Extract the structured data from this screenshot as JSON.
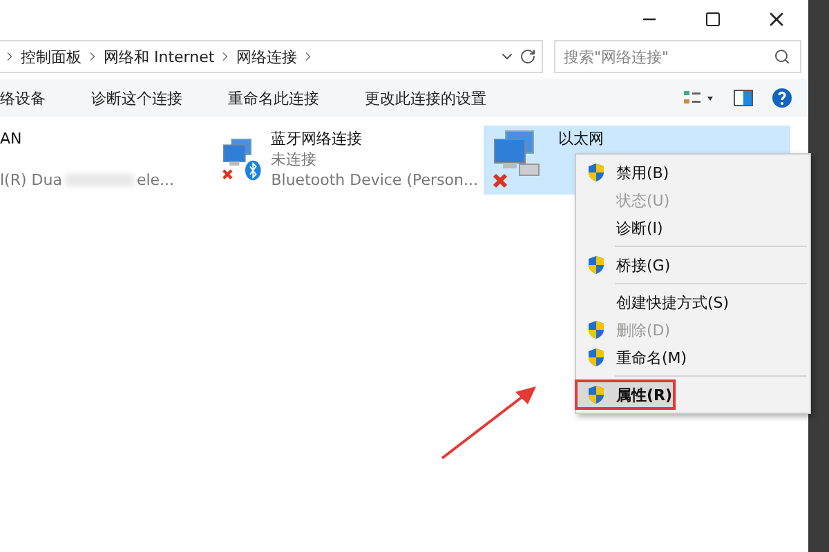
{
  "breadcrumb": [
    "控制面板",
    "网络和 Internet",
    "网络连接"
  ],
  "search": {
    "placeholder": "搜索\"网络连接\""
  },
  "toolbar": [
    "络设备",
    "诊断这个连接",
    "重命名此连接",
    "更改此连接的设置"
  ],
  "connections": [
    {
      "kind": "wifi",
      "lines": [
        "AN",
        "l(R) Dua",
        "ele..."
      ],
      "selected": false
    },
    {
      "kind": "bluetooth",
      "lines": [
        "蓝牙网络连接",
        "未连接",
        "Bluetooth Device (Person..."
      ],
      "selected": false
    },
    {
      "kind": "ethernet",
      "lines": [
        "以太网"
      ],
      "selected": true
    }
  ],
  "context_menu": [
    [
      {
        "label": "禁用(B)",
        "shield": true,
        "disabled": false,
        "selected": false
      },
      {
        "label": "状态(U)",
        "shield": false,
        "disabled": true,
        "selected": false
      },
      {
        "label": "诊断(I)",
        "shield": false,
        "disabled": false,
        "selected": false
      }
    ],
    [
      {
        "label": "桥接(G)",
        "shield": true,
        "disabled": false,
        "selected": false
      }
    ],
    [
      {
        "label": "创建快捷方式(S)",
        "shield": false,
        "disabled": false,
        "selected": false
      },
      {
        "label": "删除(D)",
        "shield": true,
        "disabled": true,
        "selected": false
      },
      {
        "label": "重命名(M)",
        "shield": true,
        "disabled": false,
        "selected": false
      }
    ],
    [
      {
        "label": "属性(R)",
        "shield": true,
        "disabled": false,
        "selected": true
      }
    ]
  ]
}
